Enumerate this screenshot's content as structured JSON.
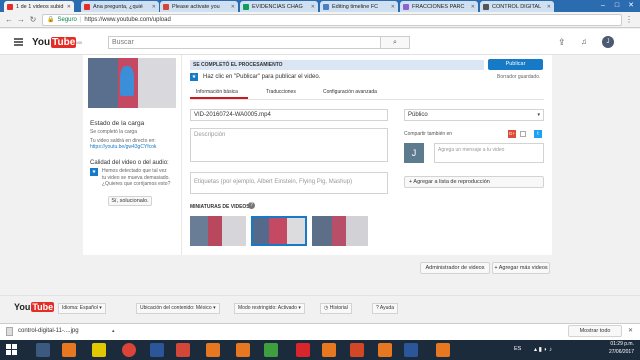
{
  "browser": {
    "tabs": [
      {
        "label": "1 de 1 videos subid",
        "color": "#e52d27"
      },
      {
        "label": "Ana pregunta, ¿quié",
        "color": "#e52d27"
      },
      {
        "label": "Please activate you",
        "color": "#d44638"
      },
      {
        "label": "EVIDENCIAS CHAG",
        "color": "#0f9d58"
      },
      {
        "label": "Editing timeline FC",
        "color": "#4a7fc1"
      },
      {
        "label": "FRACCIONES PARC",
        "color": "#8e63ce"
      },
      {
        "label": "CONTROL DIGITAL",
        "color": "#555555"
      }
    ],
    "secure_label": "Seguro",
    "url": "https://www.youtube.com/upload"
  },
  "yt": {
    "logo_you": "You",
    "logo_tube": "Tube",
    "logo_region": "MX",
    "search_placeholder": "Buscar",
    "avatar_letter": "J"
  },
  "left": {
    "status_title": "Estado de la carga",
    "status_line1": "Se completó la carga",
    "status_line2": "Tu video saldrá en directo en:",
    "status_link": "https://youtu.be/gw43gCYfcok",
    "quality_title": "Calidad del video o del audio:",
    "quality_text": "Hemos detectado que tal vez tu video se mueva demasiado. ¿Quieres que corrijamos esto?",
    "quality_button": "Sí, solucionalo."
  },
  "main": {
    "processing": "SE COMPLETÓ EL PROCESAMIENTO",
    "publish_hint": "Haz clic en \"Publicar\" para publicar el video.",
    "publish_button": "Publicar",
    "draft_saved": "Borrador guardado.",
    "tabs": [
      "Información básica",
      "Traducciones",
      "Configuración avanzada"
    ],
    "title_value": "VID-20160724-WA0005.mp4",
    "description_placeholder": "Descripción",
    "tags_placeholder": "Etiquetas (por ejemplo, Albert Einstein, Flying Pig, Mashup)",
    "privacy": "Público",
    "share_label": "Compartir también en",
    "message_placeholder": "Agrega un mensaje a tu video",
    "playlist_button": "+ Agregar a lista de reproducción",
    "thumbs_label": "MINIATURAS DE VIDEOS",
    "user_letter": "J"
  },
  "actions": {
    "manager_button": "Administrador de videos",
    "add_more_button": "+ Agregar más videos"
  },
  "footer": {
    "language": "Idioma: Español",
    "location": "Ubicación del contenido: México",
    "restricted": "Modo restringido: Activado",
    "history": "Historial",
    "help": "Ayuda"
  },
  "download": {
    "filename": "control-digital-11-....jpg",
    "show_all": "Mostrar todo"
  },
  "taskbar": {
    "language": "ES",
    "time": "01:29 p.m.",
    "date": "27/06/2017"
  }
}
